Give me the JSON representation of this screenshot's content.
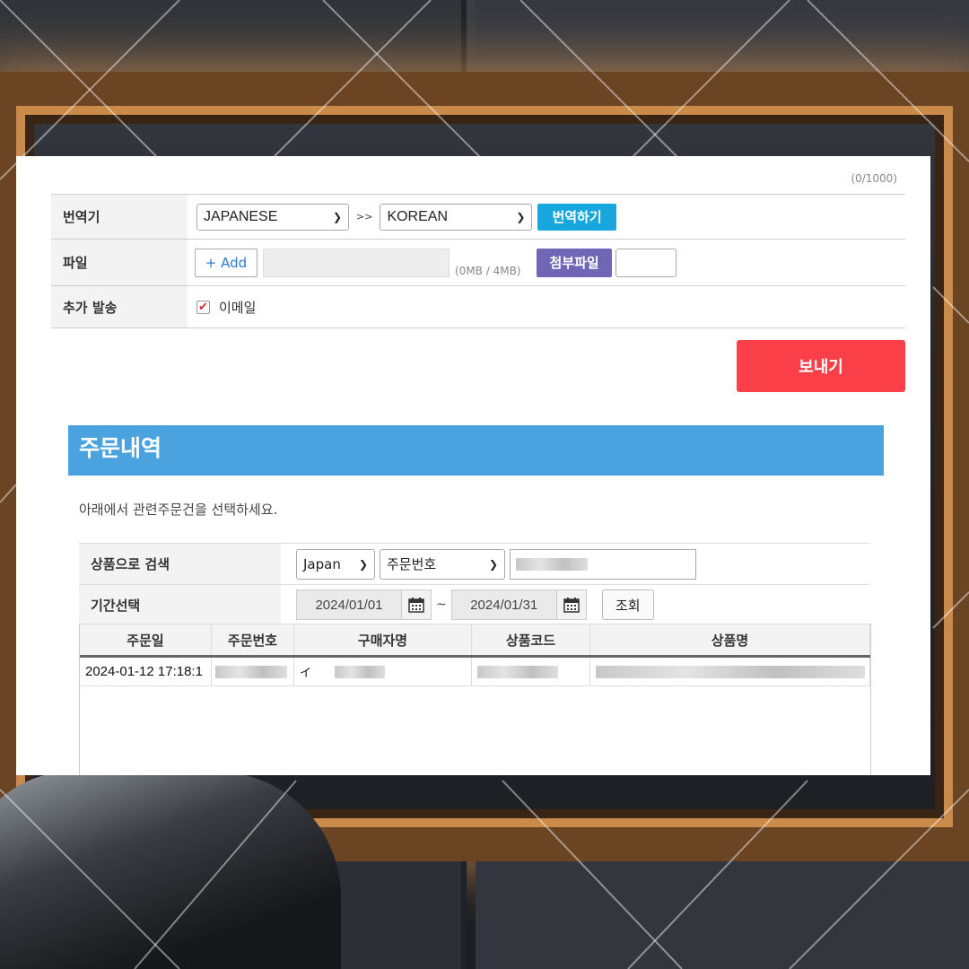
{
  "form": {
    "char_count": "(0/1000)",
    "translator": {
      "label": "번역기",
      "source_lang": "JAPANESE",
      "separator": ">>",
      "target_lang": "KOREAN",
      "translate_button": "번역하기"
    },
    "file": {
      "label": "파일",
      "add_button": "+ Add",
      "size_text": "(0MB / 4MB)",
      "attach_button": "첨부파일"
    },
    "extra": {
      "label": "추가 발송",
      "email_label": "이메일",
      "email_checked": true
    },
    "send_button": "보내기"
  },
  "orders": {
    "title": "주문내역",
    "description": "아래에서 관련주문건을 선택하세요.",
    "search": {
      "label": "상품으로 검색",
      "country": "Japan",
      "field": "주문번호"
    },
    "period": {
      "label": "기간선택",
      "start": "2024/01/01",
      "tilde": "~",
      "end": "2024/01/31",
      "search_button": "조회"
    },
    "table": {
      "columns": [
        "주문일",
        "주문번호",
        "구매자명",
        "상품코드",
        "상품명"
      ],
      "rows": [
        {
          "date": "2024-01-12 17:18:1",
          "buyer_initial": "イ"
        }
      ]
    }
  },
  "colors": {
    "translate_button": "#17a6dd",
    "attach_button": "#7066b6",
    "send_button": "#fa3f48",
    "order_header": "#4aa2de"
  }
}
